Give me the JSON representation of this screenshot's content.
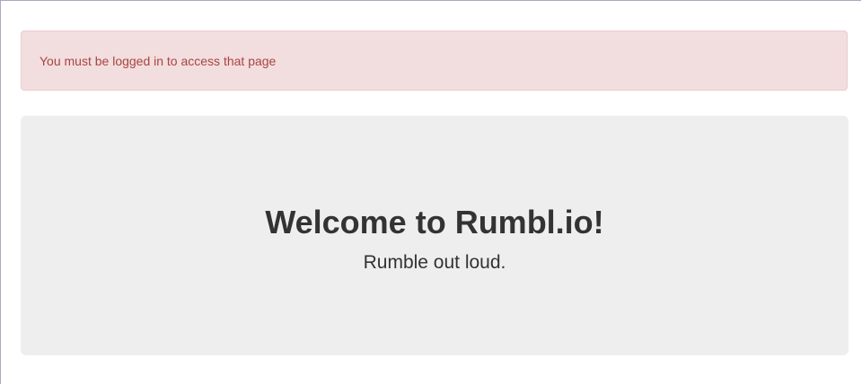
{
  "alert": {
    "message": "You must be logged in to access that page"
  },
  "jumbotron": {
    "title": "Welcome to Rumbl.io!",
    "tagline": "Rumble out loud."
  },
  "colors": {
    "alert_background": "#f2dede",
    "alert_border": "#ebccd1",
    "alert_text": "#a94442",
    "jumbotron_background": "#eeeeee",
    "heading_text": "#333333"
  }
}
